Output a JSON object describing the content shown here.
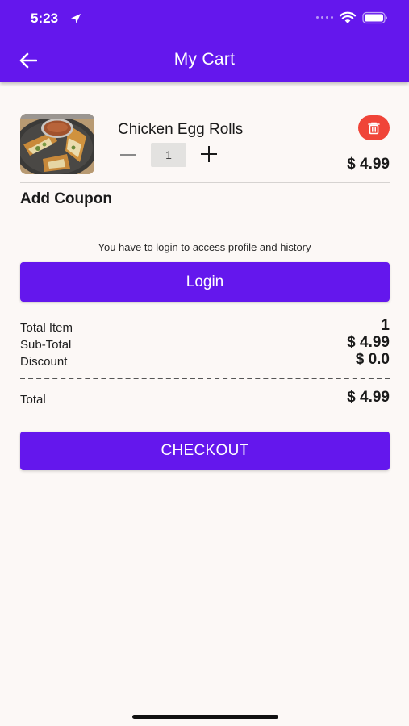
{
  "status_bar": {
    "time": "5:23",
    "icons": [
      "location-arrow-icon",
      "signal-icon",
      "wifi-icon",
      "battery-icon"
    ]
  },
  "header": {
    "title": "My Cart",
    "back_icon": "arrow-left-icon",
    "background_color": "#6417ed"
  },
  "cart": {
    "items": [
      {
        "name": "Chicken Egg Rolls",
        "quantity": "1",
        "price": "$ 4.99",
        "image": "egg-rolls-photo",
        "delete_icon": "trash-icon"
      }
    ]
  },
  "coupon": {
    "label": "Add Coupon"
  },
  "login": {
    "note": "You have to login to access profile and history",
    "button_label": "Login"
  },
  "summary": {
    "total_item_label": "Total Item",
    "total_item_value": "1",
    "subtotal_label": "Sub-Total",
    "subtotal_value": "$ 4.99",
    "discount_label": "Discount",
    "discount_value": "$ 0.0",
    "total_label": "Total",
    "total_value": "$ 4.99"
  },
  "checkout": {
    "button_label": "CHECKOUT"
  },
  "colors": {
    "accent": "#6417ed",
    "delete": "#f04438",
    "background": "#fcf8f6"
  }
}
